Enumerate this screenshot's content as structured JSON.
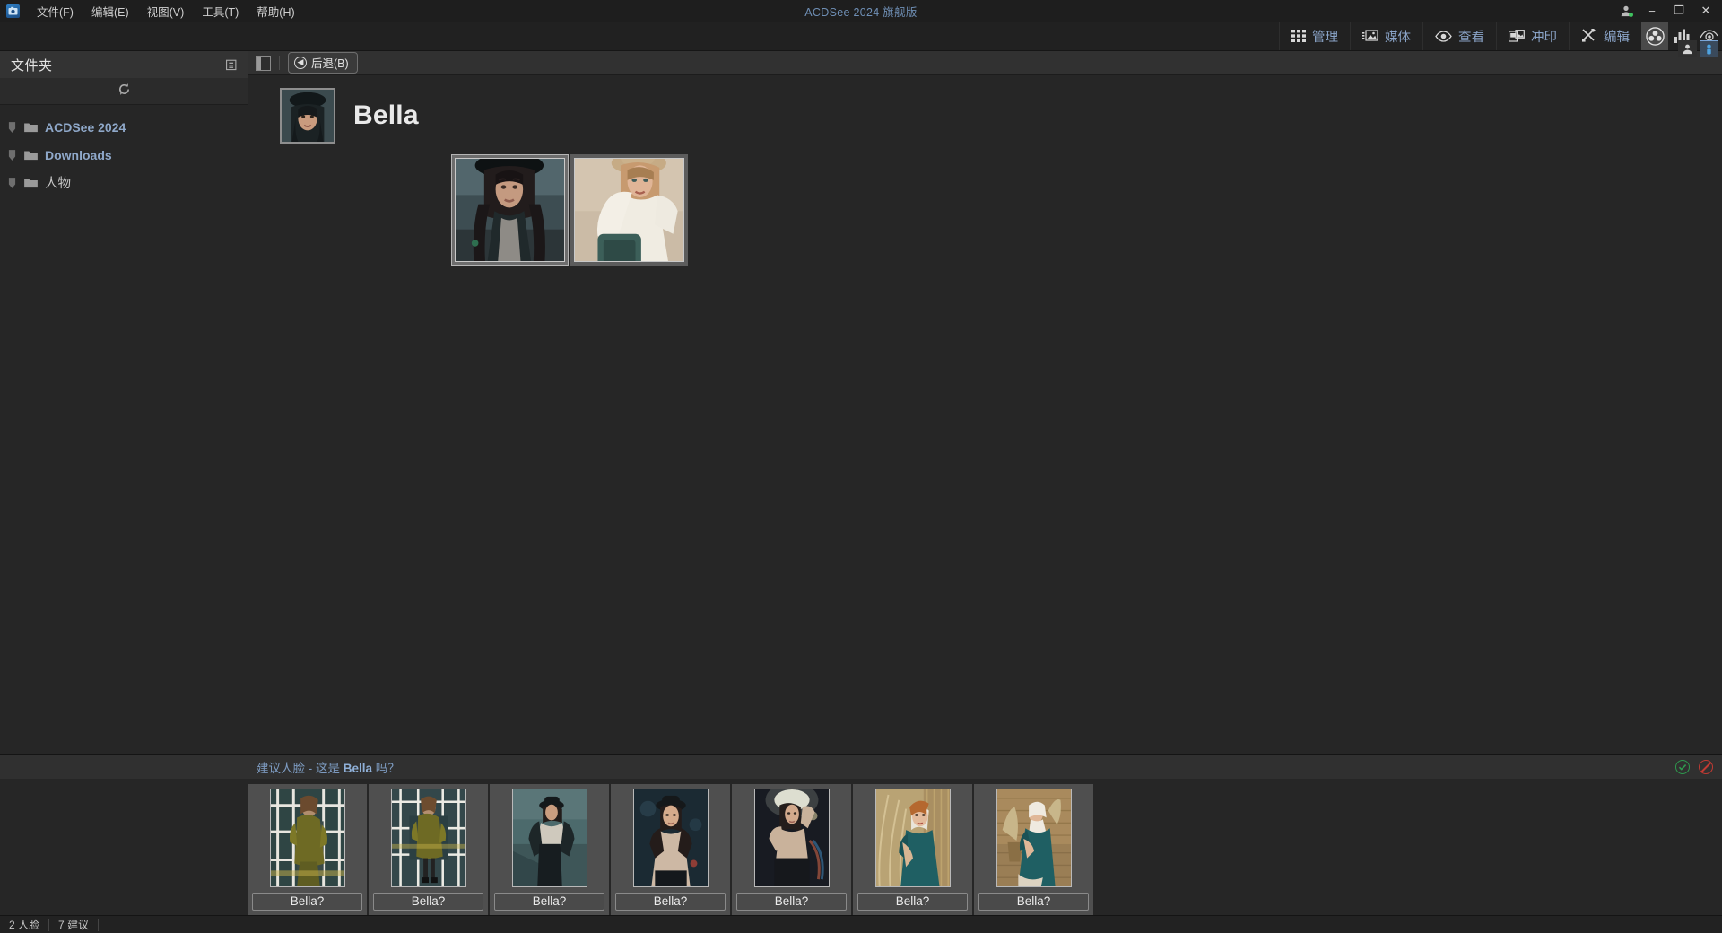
{
  "window": {
    "title": "ACDSee 2024 旗舰版",
    "logo_icon": "acdsee-logo-icon",
    "account_icon": "account-avatar-icon",
    "minimize_label": "−",
    "maximize_label": "❐",
    "close_label": "✕"
  },
  "menu": {
    "items": [
      {
        "label": "文件(F)",
        "name": "menu-file"
      },
      {
        "label": "编辑(E)",
        "name": "menu-edit"
      },
      {
        "label": "视图(V)",
        "name": "menu-view"
      },
      {
        "label": "工具(T)",
        "name": "menu-tools"
      },
      {
        "label": "帮助(H)",
        "name": "menu-help"
      }
    ]
  },
  "modebar": {
    "modes": [
      {
        "label": "管理",
        "icon": "grid-icon"
      },
      {
        "label": "媒体",
        "icon": "media-image-icon"
      },
      {
        "label": "查看",
        "icon": "eye-icon"
      },
      {
        "label": "冲印",
        "icon": "print-icon"
      },
      {
        "label": "编辑",
        "icon": "edit-tools-icon"
      }
    ],
    "icons": [
      {
        "name": "people-faces-icon",
        "active": true
      },
      {
        "name": "histogram-chart-icon",
        "active": false
      },
      {
        "name": "view-preview-icon",
        "active": false
      }
    ]
  },
  "sidebar": {
    "header_title": "文件夹",
    "header_icon": "folder-tree-icon",
    "refresh_icon": "refresh-icon",
    "items": [
      {
        "label": "ACDSee 2024",
        "cjk": false
      },
      {
        "label": "Downloads",
        "cjk": false
      },
      {
        "label": "人物",
        "cjk": true
      }
    ]
  },
  "crumbbar": {
    "panel_toggle_icon": "left-panel-toggle-icon",
    "back_label": "后退(B)",
    "back_icon": "arrow-left-circle-icon"
  },
  "face": {
    "avatar_icon": "face-avatar-thumbnail",
    "name": "Bella"
  },
  "thumbnails": [
    {
      "name": "thumbnail-bella-hat-dark",
      "selected": true
    },
    {
      "name": "thumbnail-bella-sweater-beige",
      "selected": false
    }
  ],
  "suggest": {
    "title_prefix": "建议人脸 - 这是 ",
    "title_name": "Bella",
    "title_suffix": " 吗？",
    "accept_icon": "accept-check-icon",
    "reject_icon": "reject-deny-icon",
    "items": [
      {
        "label": "Bella?",
        "name": "suggested-face-1"
      },
      {
        "label": "Bella?",
        "name": "suggested-face-2"
      },
      {
        "label": "Bella?",
        "name": "suggested-face-3"
      },
      {
        "label": "Bella?",
        "name": "suggested-face-4"
      },
      {
        "label": "Bella?",
        "name": "suggested-face-5"
      },
      {
        "label": "Bella?",
        "name": "suggested-face-6"
      },
      {
        "label": "Bella?",
        "name": "suggested-face-7"
      }
    ]
  },
  "statusbar": {
    "faces_count": "2 人脸",
    "suggestions_count": "7 建议"
  },
  "right_edge": {
    "buttons": [
      {
        "name": "person-panel-icon",
        "on": false
      },
      {
        "name": "people-panel-icon",
        "on": true
      }
    ]
  },
  "colors": {
    "accent_blue": "#8aa4c8",
    "title_blue": "#6f8fb5",
    "bg": "#262626",
    "panel": "#333333",
    "accept_green": "#2e9a4e",
    "reject_red": "#c23a33"
  }
}
